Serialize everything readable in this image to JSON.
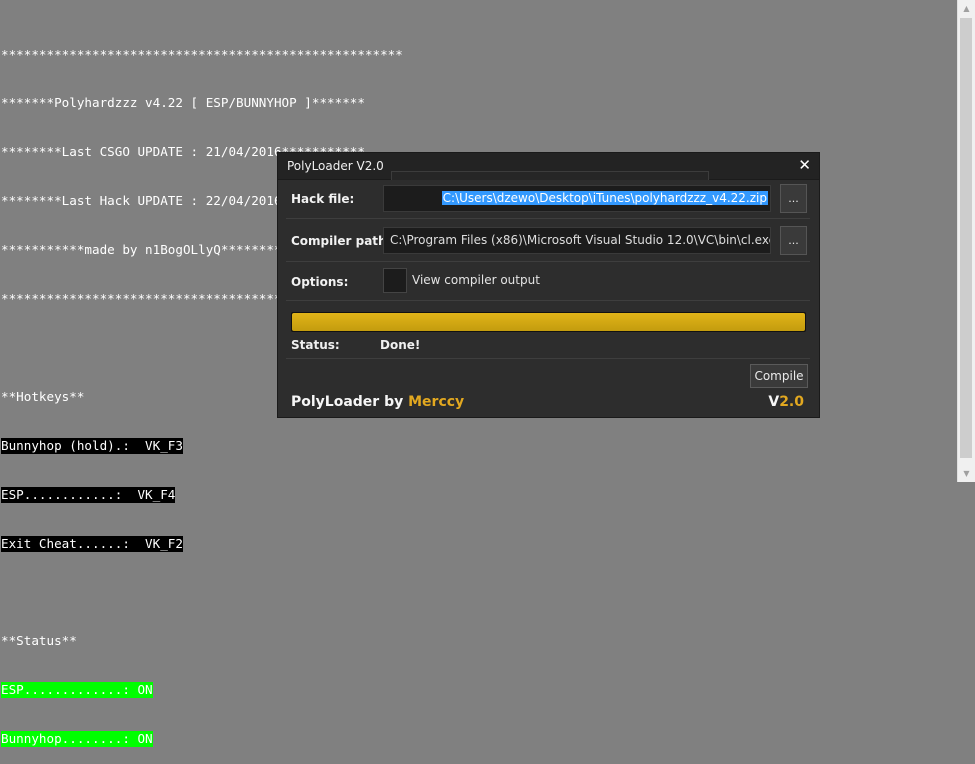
{
  "console": {
    "lines": [
      "*****************************************************",
      "*******Polyhardzzz v4.22 [ ESP/BUNNYHOP ]*******",
      "********Last CSGO UPDATE : 21/04/2016***********",
      "********Last Hack UPDATE : 22/04/2016***********",
      "***********made by n1BogOLlyQ*******************",
      "*****************************************************",
      "",
      "**Hotkeys**"
    ],
    "hotkeys": [
      "Bunnyhop (hold).:  VK_F3",
      "ESP............:  VK_F4",
      "Exit Cheat......:  VK_F2"
    ],
    "status_header": "**Status**",
    "status_lines": [
      "ESP.............: ON",
      "Bunnyhop........: ON"
    ]
  },
  "dialog": {
    "title": "PolyLoader V2.0",
    "close_glyph": "✕",
    "hack_file_label": "Hack file:",
    "hack_file_value": "C:\\Users\\dzewo\\Desktop\\iTunes\\polyhardzzz_v4.22.zip",
    "compiler_path_label": "Compiler path:",
    "compiler_path_value": "C:\\Program Files (x86)\\Microsoft Visual Studio 12.0\\VC\\bin\\cl.exe",
    "browse_label": "...",
    "options_label": "Options:",
    "view_compiler_output_label": "View compiler output",
    "view_compiler_output_checked": false,
    "progress_fraction": 1.0,
    "status_label": "Status:",
    "status_value": "Done!",
    "compile_label": "Compile",
    "brand_prefix": "PolyLoader by ",
    "brand_author": "Merccy",
    "version_prefix": "V",
    "version_number": "2.0",
    "accent_color": "#e2a820",
    "progress_color": "#d4aa14"
  },
  "scrollbar": {
    "up_icon": "▲",
    "down_icon": "▼"
  }
}
